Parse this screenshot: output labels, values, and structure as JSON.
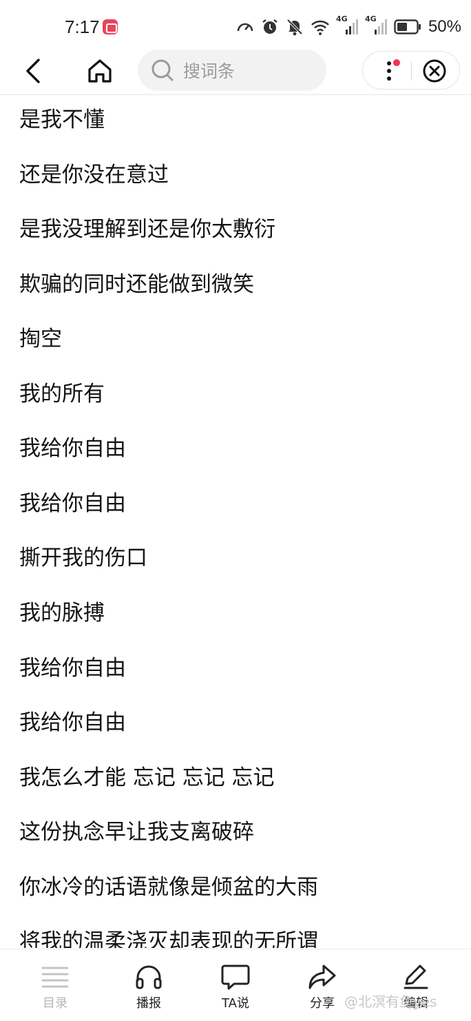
{
  "status_bar": {
    "time": "7:17",
    "battery_percent": "50%",
    "network_labels": [
      "4G",
      "4G"
    ]
  },
  "nav": {
    "search_placeholder": "搜词条"
  },
  "lyrics": [
    "是我不懂",
    "还是你没在意过",
    "是我没理解到还是你太敷衍",
    "欺骗的同时还能做到微笑",
    "掏空",
    "我的所有",
    "我给你自由",
    "我给你自由",
    "撕开我的伤口",
    "我的脉搏",
    "我给你自由",
    "我给你自由",
    "我怎么才能 忘记 忘记 忘记",
    "这份执念早让我支离破碎",
    "你冰冷的话语就像是倾盆的大雨",
    "将我的温柔浇灭却表现的无所谓"
  ],
  "bottom_tabs": [
    {
      "label": "目录",
      "icon": "list-icon"
    },
    {
      "label": "播报",
      "icon": "headphones-icon"
    },
    {
      "label": "TA说",
      "icon": "comment-icon"
    },
    {
      "label": "分享",
      "icon": "share-icon"
    },
    {
      "label": "编辑",
      "icon": "edit-icon"
    }
  ],
  "watermark": "@北溟有鱼yes",
  "colors": {
    "notification_dot": "#f0364f",
    "app_badge": "#e8455c"
  }
}
